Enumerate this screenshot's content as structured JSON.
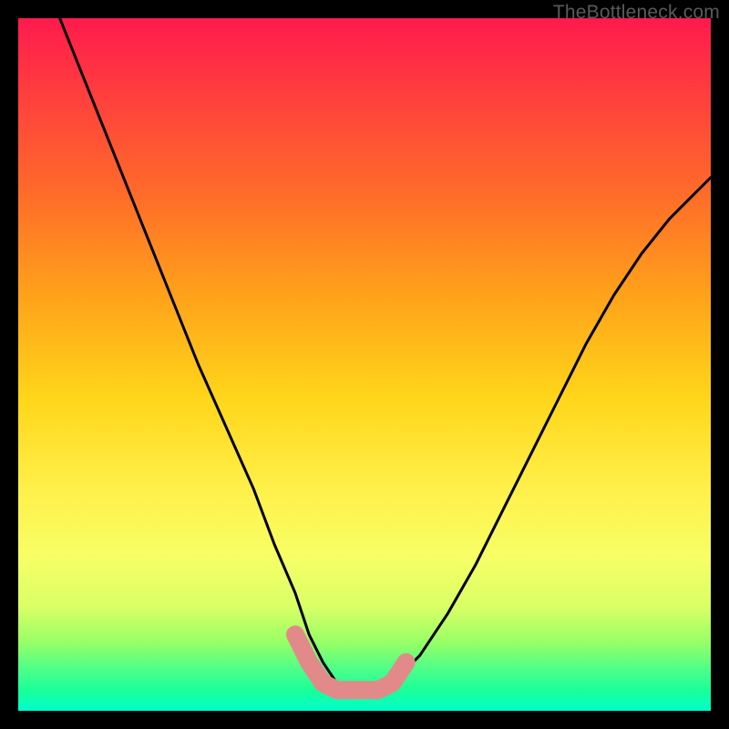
{
  "watermark": "TheBottleneck.com",
  "chart_data": {
    "type": "line",
    "title": "",
    "xlabel": "",
    "ylabel": "",
    "xlim": [
      0,
      100
    ],
    "ylim": [
      0,
      100
    ],
    "series": [
      {
        "name": "bottleneck-curve",
        "x": [
          6,
          10,
          14,
          18,
          22,
          26,
          30,
          34,
          37,
          40,
          42,
          44,
          46,
          48,
          50,
          52,
          54,
          58,
          62,
          66,
          70,
          74,
          78,
          82,
          86,
          90,
          94,
          98,
          100
        ],
        "y": [
          100,
          90,
          80,
          70,
          60,
          50,
          41,
          32,
          24,
          17,
          11,
          7,
          4,
          3,
          3,
          3,
          4,
          8,
          14,
          21,
          29,
          37,
          45,
          53,
          60,
          66,
          71,
          75,
          77
        ]
      },
      {
        "name": "highlight-segment",
        "x": [
          40,
          42,
          44,
          46,
          48,
          50,
          52,
          54,
          56
        ],
        "y": [
          11,
          7,
          4,
          3,
          3,
          3,
          3,
          4,
          7
        ]
      }
    ],
    "gradient_stops": [
      {
        "pos": 0.0,
        "color": "#ff1a4d"
      },
      {
        "pos": 0.1,
        "color": "#ff3b3f"
      },
      {
        "pos": 0.25,
        "color": "#ff6a2a"
      },
      {
        "pos": 0.4,
        "color": "#ffa21a"
      },
      {
        "pos": 0.55,
        "color": "#ffd61a"
      },
      {
        "pos": 0.68,
        "color": "#fff04a"
      },
      {
        "pos": 0.78,
        "color": "#f7ff66"
      },
      {
        "pos": 0.85,
        "color": "#d9ff66"
      },
      {
        "pos": 0.9,
        "color": "#99ff66"
      },
      {
        "pos": 0.94,
        "color": "#4dff88"
      },
      {
        "pos": 0.97,
        "color": "#1aff99"
      },
      {
        "pos": 1.0,
        "color": "#00ffcc"
      }
    ],
    "colors": {
      "curve": "#000000",
      "highlight": "#e28a8a",
      "frame": "#000000"
    }
  }
}
